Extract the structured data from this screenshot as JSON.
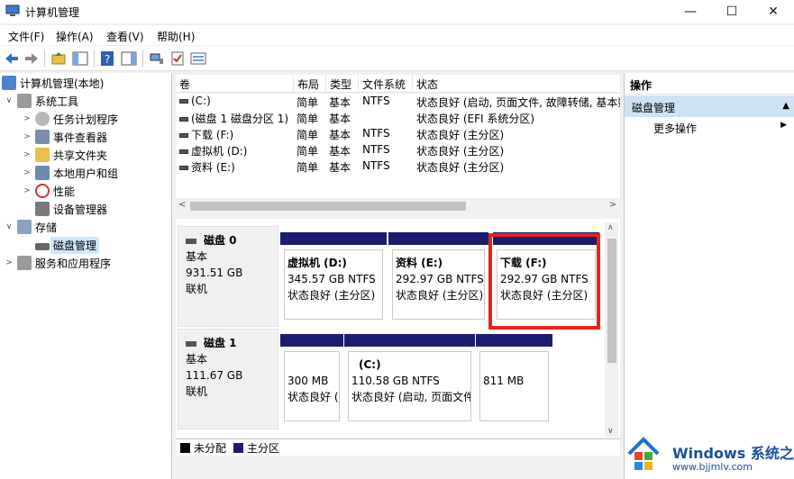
{
  "window": {
    "title": "计算机管理"
  },
  "menu": [
    "文件(F)",
    "操作(A)",
    "查看(V)",
    "帮助(H)"
  ],
  "tree": {
    "root": "计算机管理(本地)",
    "system_tools": "系统工具",
    "task_scheduler": "任务计划程序",
    "event_viewer": "事件查看器",
    "shared_folders": "共享文件夹",
    "local_users": "本地用户和组",
    "performance": "性能",
    "device_manager": "设备管理器",
    "storage": "存储",
    "disk_management": "磁盘管理",
    "services": "服务和应用程序"
  },
  "volume_list": {
    "columns": [
      "卷",
      "布局",
      "类型",
      "文件系统",
      "状态"
    ],
    "rows": [
      {
        "volume": "(C:)",
        "layout": "简单",
        "type": "基本",
        "fs": "NTFS",
        "status": "状态良好 (启动, 页面文件, 故障转储, 基本数"
      },
      {
        "volume": "(磁盘 1 磁盘分区 1)",
        "layout": "简单",
        "type": "基本",
        "fs": "",
        "status": "状态良好 (EFI 系统分区)"
      },
      {
        "volume": "下载 (F:)",
        "layout": "简单",
        "type": "基本",
        "fs": "NTFS",
        "status": "状态良好 (主分区)"
      },
      {
        "volume": "虚拟机 (D:)",
        "layout": "简单",
        "type": "基本",
        "fs": "NTFS",
        "status": "状态良好 (主分区)"
      },
      {
        "volume": "资料 (E:)",
        "layout": "简单",
        "type": "基本",
        "fs": "NTFS",
        "status": "状态良好 (主分区)"
      }
    ]
  },
  "disks": [
    {
      "name": "磁盘 0",
      "type": "基本",
      "size": "931.51 GB",
      "state": "联机",
      "partitions": [
        {
          "name": "虚拟机  (D:)",
          "size": "345.57 GB NTFS",
          "status": "状态良好 (主分区)"
        },
        {
          "name": "资料  (E:)",
          "size": "292.97 GB NTFS",
          "status": "状态良好 (主分区)"
        },
        {
          "name": "下载  (F:)",
          "size": "292.97 GB NTFS",
          "status": "状态良好 (主分区)"
        }
      ]
    },
    {
      "name": "磁盘 1",
      "type": "基本",
      "size": "111.67 GB",
      "state": "联机",
      "partitions": [
        {
          "name": "",
          "size": "300 MB",
          "status": "状态良好 ("
        },
        {
          "name": "(C:)",
          "size": "110.58 GB NTFS",
          "status": "状态良好 (启动, 页面文件"
        },
        {
          "name": "",
          "size": "811 MB",
          "status": ""
        }
      ]
    }
  ],
  "legend": {
    "unallocated": "未分配",
    "primary": "主分区"
  },
  "actions": {
    "header": "操作",
    "section": "磁盘管理",
    "more": "更多操作"
  },
  "watermark": {
    "line1": "Windows 系统之家",
    "line2": "www.bjjmlv.com"
  },
  "colors": {
    "partition_bar": "#1c1c6e",
    "highlight": "#e8231b",
    "selection": "#cce8ff",
    "actions_section": "#cfe3f7"
  }
}
